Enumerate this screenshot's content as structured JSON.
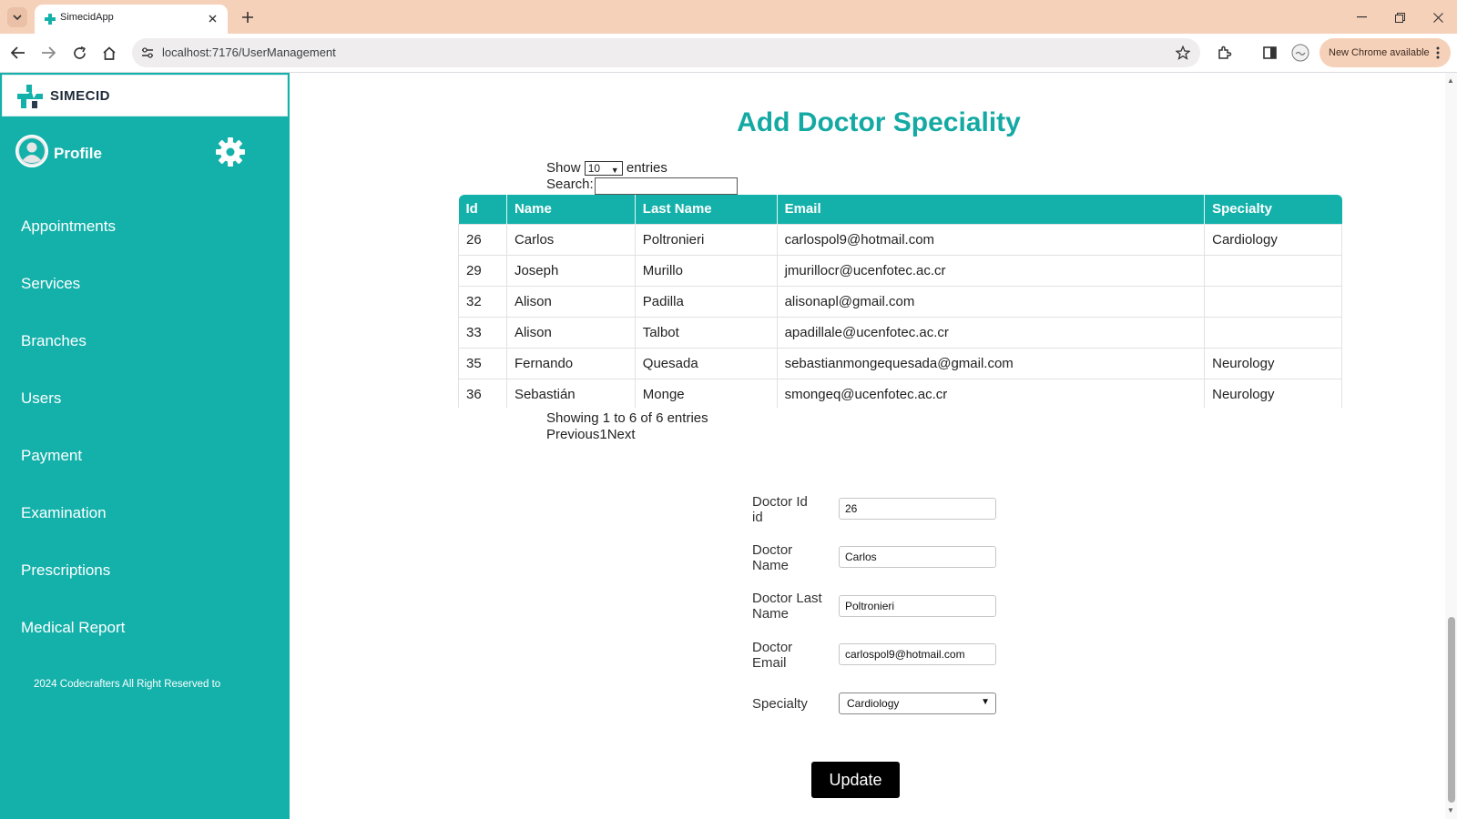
{
  "browser": {
    "tab_title": "SimecidApp",
    "url": "localhost:7176/UserManagement",
    "new_chrome_label": "New Chrome available"
  },
  "sidebar": {
    "brand": "SIMECID",
    "profile_label": "Profile",
    "nav_items": [
      {
        "label": "Appointments"
      },
      {
        "label": "Services"
      },
      {
        "label": "Branches"
      },
      {
        "label": "Users"
      },
      {
        "label": "Payment"
      },
      {
        "label": "Examination"
      },
      {
        "label": "Prescriptions"
      },
      {
        "label": "Medical Report"
      }
    ],
    "copyright": "2024 Codecrafters All Right Reserved to"
  },
  "main": {
    "title": "Add Doctor Speciality",
    "show_label": "Show",
    "entries_value": "10",
    "entries_label": "entries",
    "search_label": "Search:",
    "search_value": "",
    "table": {
      "headers": [
        "Id",
        "Name",
        "Last Name",
        "Email",
        "Specialty"
      ],
      "rows": [
        {
          "id": "26",
          "name": "Carlos",
          "last_name": "Poltronieri",
          "email": "carlospol9@hotmail.com",
          "specialty": "Cardiology"
        },
        {
          "id": "29",
          "name": "Joseph",
          "last_name": "Murillo",
          "email": "jmurillocr@ucenfotec.ac.cr",
          "specialty": ""
        },
        {
          "id": "32",
          "name": "Alison",
          "last_name": "Padilla",
          "email": "alisonapl@gmail.com",
          "specialty": ""
        },
        {
          "id": "33",
          "name": "Alison",
          "last_name": "Talbot",
          "email": "apadillale@ucenfotec.ac.cr",
          "specialty": ""
        },
        {
          "id": "35",
          "name": "Fernando",
          "last_name": "Quesada",
          "email": "sebastianmongequesada@gmail.com",
          "specialty": "Neurology"
        },
        {
          "id": "36",
          "name": "Sebastián",
          "last_name": "Monge",
          "email": "smongeq@ucenfotec.ac.cr",
          "specialty": "Neurology"
        }
      ]
    },
    "showing_text": "Showing 1 to 6 of 6 entries",
    "pager": {
      "previous": "Previous",
      "page": "1",
      "next": "Next"
    },
    "form": {
      "doctor_id_label_line1": "Doctor Id",
      "doctor_id_label_line2": "id",
      "doctor_id_value": "26",
      "doctor_name_label_line1": "Doctor",
      "doctor_name_label_line2": "Name",
      "doctor_name_value": "Carlos",
      "doctor_last_name_label_line1": "Doctor Last",
      "doctor_last_name_label_line2": "Name",
      "doctor_last_name_value": "Poltronieri",
      "doctor_email_label_line1": "Doctor",
      "doctor_email_label_line2": "Email",
      "doctor_email_value": "carlospol9@hotmail.com",
      "specialty_label": "Specialty",
      "specialty_value": "Cardiology",
      "update_label": "Update"
    }
  },
  "colors": {
    "accent": "#14b1ab",
    "title": "#15a9a4",
    "tabstrip": "#f6d1b9"
  },
  "icons": [
    "tab-search-icon",
    "favicon-icon",
    "close-icon",
    "plus-icon",
    "minimize-icon",
    "restore-icon",
    "back-icon",
    "forward-icon",
    "reload-icon",
    "home-icon",
    "site-settings-icon",
    "star-icon",
    "extensions-icon",
    "side-panel-icon",
    "profile-icon",
    "more-icon",
    "logo-icon",
    "avatar-icon",
    "gear-icon"
  ]
}
